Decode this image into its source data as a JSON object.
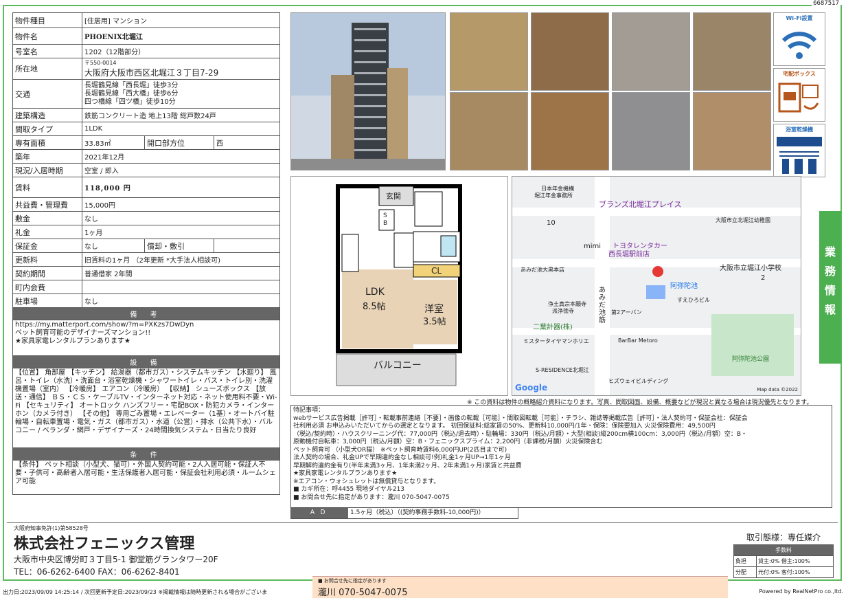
{
  "doc_id": "6687517",
  "spec": {
    "type_label": "物件種目",
    "type_value": "[住居用] マンション",
    "name_label": "物件名",
    "name_value": "PHOENIX北堀江",
    "room_label": "号室名",
    "room_value": "1202（12階部分）",
    "address_label": "所在地",
    "postal": "〒550-0014",
    "address": "大阪府大阪市西区北堀江３丁目7-29",
    "access_label": "交通",
    "access": [
      "長堀鶴見線「西長堀」徒歩3分",
      "長堀鶴見線「西大橋」徒歩6分",
      "四つ橋線「四ツ橋」徒歩10分"
    ],
    "structure_label": "建築構造",
    "structure_value": "鉄筋コンクリート造 地上13階 総戸数24戸",
    "layout_label": "間取タイプ",
    "layout_value": "1LDK",
    "area_label": "専有面積",
    "area_value": "33.83㎡",
    "dir_label": "開口部方位",
    "dir_value": "西",
    "built_label": "築年",
    "built_value": "2021年12月",
    "status_label": "現況/入居時期",
    "status_value": "空室 / 即入",
    "rent_label": "賃料",
    "rent_value": "118,000 円",
    "fee_label": "共益費・管理費",
    "fee_value": "15,000円",
    "deposit_label": "敷金",
    "deposit_value": "なし",
    "key_label": "礼金",
    "key_value": "1ヶ月",
    "guarantee_label": "保証金",
    "guarantee_value": "なし",
    "amort_label": "償却・敷引",
    "amort_value": "",
    "renew_label": "更新料",
    "renew_value": "旧賃料の1ヶ月 （2年更新 *大手法人相談可)",
    "contract_label": "契約期間",
    "contract_value": "普通借家 2年間",
    "town_label": "町内会費",
    "town_value": "",
    "parking_label": "駐車場",
    "parking_value": "なし"
  },
  "remarks_section": {
    "title": "備 考",
    "lines": [
      "https://my.matterport.com/show/?m=PXKzs7DwDyn",
      "ペット飼育可能のデザイナーズマンション!!",
      "★家具家電レンタルプランあります★"
    ]
  },
  "facility_section": {
    "title": "設 備",
    "text": "【位置】 角部屋 【キッチン】 給湯器（都市ガス）・システムキッチン 【水廻り】 風呂・トイレ（水洗）・洗面台・浴室乾燥機・シャワートイレ・バス・トイレ別・洗濯機置場（室内） 【冷暖房】 エアコン（冷暖房） 【収納】 シューズボックス 【放送・通信】 ＢＳ・ＣＳ・ケーブルTV・インターネット対応・ネット使用料不要・Wi-Fi 【セキュリティ】 オートロック ハンズフリー・宅配BOX・防犯カメラ・インターホン（カメラ付き） 【その他】 専用ごみ置場・エレベーター（1基）・オートバイ駐輪場・自転車置場・電気・ガス（都市ガス）・水道（公営）・排水（公共下水）・バルコニー / ベランダ・網戸・デザイナーズ・24時間換気システム・日当たり良好"
  },
  "condition_section": {
    "title": "条 件",
    "text": "【条件】 ペット相談（小型犬、猫可）・外国人契約可能・2人入居可能・保証人不要・子供可・高齢者入居可能・生活保護者入居可能・保証会社利用必須・ルームシェア可能"
  },
  "icons": [
    "Wi-Fi設置",
    "宅配ボックス",
    "浴室乾燥機"
  ],
  "sidebar_text": "業務情報",
  "floorplan": {
    "entrance": "玄関",
    "sb": "SB",
    "ldk": "LDK",
    "ldk_size": "8.5帖",
    "cl": "CL",
    "room": "洋室",
    "room_size": "3.5帖",
    "balcony": "バルコニー"
  },
  "map": {
    "labels": [
      "日本年金機構",
      "堀江年金事務所",
      "ブランズ北堀江プレイス",
      "大阪市立北堀江幼稚園",
      "10",
      "トヨタレンタカー",
      "西長堀駅前店",
      "mimi",
      "あみだ池大黒本店",
      "大阪市立堀江小学校",
      "2",
      "阿弥陀池",
      "すえひろビル",
      "浄土真宗本願寺",
      "派浄徳寺",
      "第2アーバン",
      "あみだ池筋",
      "二葉計器(株)",
      "ミスタータイヤマンホリエ",
      "BarBar Metoro",
      "阿弥陀池公園",
      "S-RESIDENCE北堀江",
      "ヒズウェイビルディング",
      "Google",
      "Map data ©2022"
    ]
  },
  "notice": "※ この資料は物件の概略紹介資料になります。写真、間取図面、設備、概要などが現況と異なる場合は現況優先となります。",
  "special": {
    "title": "特記事項：",
    "lines": [
      "webサービス広告掲載［許可］・転載事前連絡［不要］・画像の転載［可能］・間取図転載［可能］・チラシ、雑誌等掲載広告［許可］・法人契約可・保証会社：保証会",
      "社利用必須 お申込みいただいてからの選定となります。 初回保証料:総家賃の50%、更新料10,000円/1年・保険：保険要加入 火災保険費用：49,500円",
      "（税込/契約時）・ハウスクリーニング代：77,000円（税込/退去時）・駐輪場：330円（税込/月額）・大型(相談)縦200cm横100cm：3,000円（税込/月額）空：B・",
      "原動機付自転車：3,000円（税込/月額）空：B・フェニックスプライム：2,200円（非課税/月額）火災保険含む",
      "ペット飼育可 （小型犬OR猫） ※ペット飼育時賃料6,000円UP(2匹目まで可)",
      "法人契約の場合、礼金UPで早期違約金なし相談可!例)礼金1ヶ月UP→1年1ヶ月",
      "早期解約違約金有り(半年未満3ヶ月、1年未満2ヶ月、2年未満1ヶ月)家賃と共益費",
      "★家具家電レンタルプランあります★",
      "※エアコン・ウォシュレットは無償貸与となります。",
      "■ カギ所在：呼4455 現地ダイヤル213",
      "■ お問合せ先に指定があります：瀧川 070-5047-0075"
    ]
  },
  "ad": {
    "label": "ＡＤ",
    "value": "1.5ヶ月（税込）（(契約事務手数料-10,000円)）"
  },
  "company": {
    "license": "大阪府知事免許(1)第58528号",
    "name": "株式会社フェニックス管理",
    "address": "大阪市中央区博労町３丁目5-1 御堂筋グランタワー20F",
    "tel": "TEL：06-6262-6400 FAX：06-6262-8401"
  },
  "deal": {
    "title": "取引態様：専任媒介",
    "fee_header": "手数料",
    "rows": [
      [
        "負担",
        "貸主:0% 借主:100%"
      ],
      [
        "分配",
        "元付:0% 客付:100%"
      ]
    ]
  },
  "contact": {
    "small": "■ お問合せ先に指定があります",
    "big": "瀧川 070-5047-0075"
  },
  "footer": "出力日:2023/09/09 14:25:14 / 次回更新予定日:2023/09/23 ※掲載情報は随時更新される場合がございま",
  "powered": "Powered by RealNetPro co.,ltd."
}
